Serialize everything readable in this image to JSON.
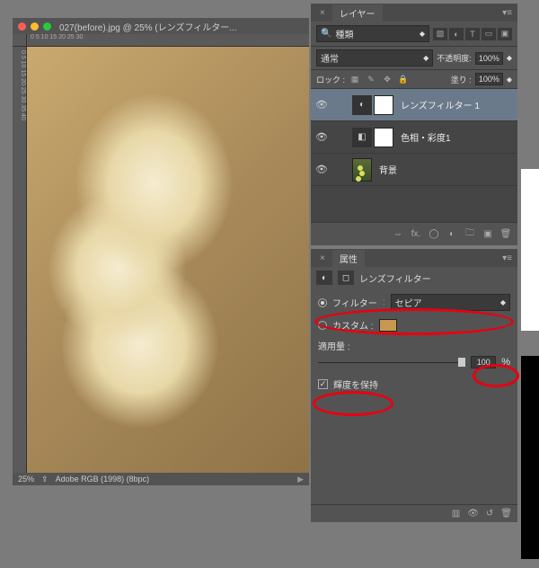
{
  "document": {
    "title": "027(before).jpg @ 25% (レンズフィルター...",
    "zoom": "25%",
    "color_profile": "Adobe RGB (1998) (8bpc)",
    "ruler_h": "0     5     10    15    20    25    30",
    "ruler_v": "0  5  10  15  20  25  30  35  40"
  },
  "layers": {
    "panel_title": "レイヤー",
    "search_kind": "種類",
    "blend_mode": "通常",
    "opacity_label": "不透明度:",
    "opacity_value": "100%",
    "lock_label": "ロック :",
    "fill_label": "塗り :",
    "fill_value": "100%",
    "items": [
      {
        "name": "レンズフィルター 1",
        "visible": true,
        "selected": true,
        "type": "adj",
        "icon": "◐"
      },
      {
        "name": "色相・彩度1",
        "visible": true,
        "selected": false,
        "type": "adj",
        "icon": "◧"
      },
      {
        "name": "背景",
        "visible": true,
        "selected": false,
        "type": "image",
        "icon": ""
      }
    ]
  },
  "properties": {
    "panel_title": "属性",
    "adj_title": "レンズフィルター",
    "filter_label": "フィルター",
    "filter_value": "セピア",
    "custom_label": "カスタム :",
    "density_label": "適用量 :",
    "density_value": "100",
    "density_unit": "%",
    "preserve_label": "輝度を保持"
  }
}
